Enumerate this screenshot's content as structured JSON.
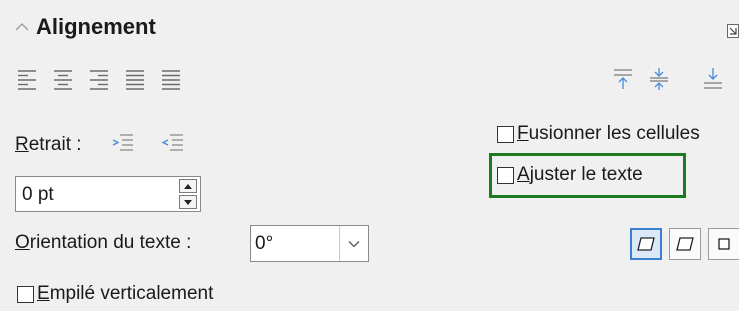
{
  "panel": {
    "title": "Alignement"
  },
  "horizontal_align": {
    "buttons": [
      "align-left-icon",
      "align-center-icon",
      "align-right-icon",
      "align-justify-icon"
    ]
  },
  "vertical_align": {
    "buttons": [
      "align-top-icon",
      "align-middle-icon",
      "align-bottom-icon"
    ]
  },
  "indent": {
    "label_accel": "R",
    "label_rest": "etrait :",
    "value": "0 pt"
  },
  "orientation": {
    "label_accel": "O",
    "label_rest": "rientation du texte :",
    "value": "0°"
  },
  "checkboxes": {
    "merge": {
      "accel": "F",
      "rest": "usionner les cellules",
      "checked": false
    },
    "wrap": {
      "accel": "A",
      "rest": "juster le texte",
      "checked": false
    },
    "stacked": {
      "accel": "E",
      "rest": "mpilé verticalement",
      "checked": false
    }
  },
  "colors": {
    "highlight": "#1e7a1e",
    "active_button": "#3a7fd0"
  }
}
